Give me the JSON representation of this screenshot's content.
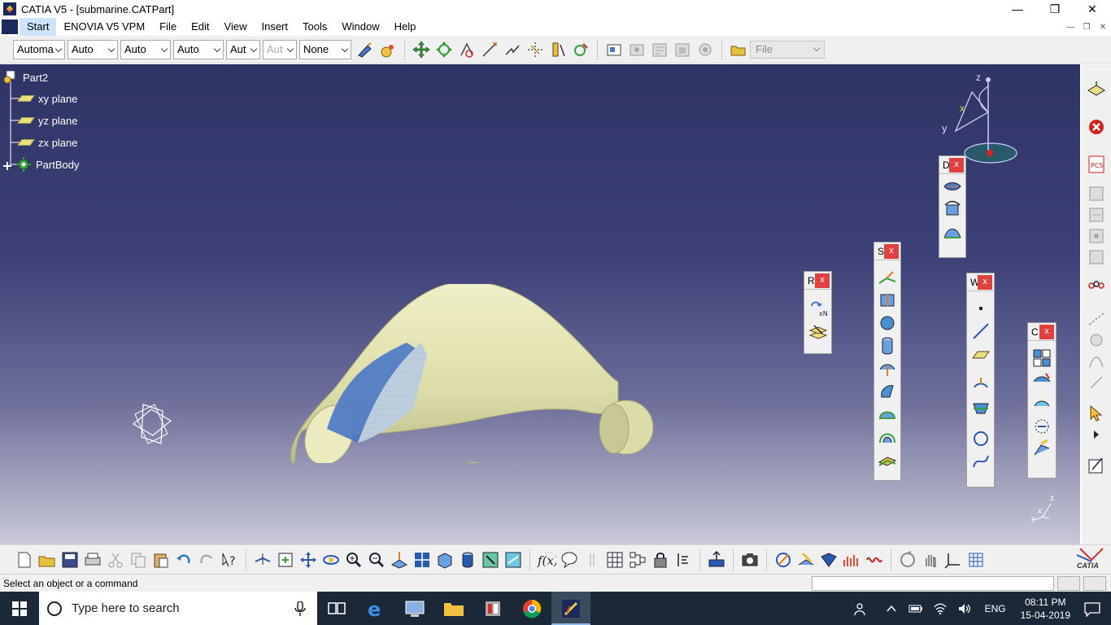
{
  "window": {
    "title": "CATIA V5 - [submarine.CATPart]"
  },
  "menu": {
    "items": [
      "Start",
      "ENOVIA V5 VPM",
      "File",
      "Edit",
      "View",
      "Insert",
      "Tools",
      "Window",
      "Help"
    ]
  },
  "toolbar": {
    "dropdowns": [
      "Automa",
      "Auto",
      "Auto",
      "Auto",
      "Aut",
      "Aut",
      "None"
    ],
    "file_label": "File"
  },
  "tree": {
    "root": "Part2",
    "items": [
      "xy plane",
      "yz plane",
      "zx plane",
      "PartBody"
    ]
  },
  "floating_toolbars": {
    "d_title": "D",
    "s_title": "S",
    "r_title": "R",
    "w_title": "W",
    "c_title": "C",
    "close": "x"
  },
  "compass": {
    "x": "x",
    "y": "y",
    "z": "z"
  },
  "axis_small": {
    "y": "y",
    "x": "x",
    "z": "z"
  },
  "status": {
    "message": "Select an object or a command"
  },
  "taskbar": {
    "search_placeholder": "Type here to search",
    "lang": "ENG",
    "time": "08:11 PM",
    "date": "15-04-2019"
  },
  "colors": {
    "viewport_top": "#2f3466",
    "viewport_bottom": "#c9c9d8",
    "hull": "#e4e4b4",
    "canopy": "#4a78c8"
  },
  "brand": {
    "logo_text": "CATIA"
  }
}
